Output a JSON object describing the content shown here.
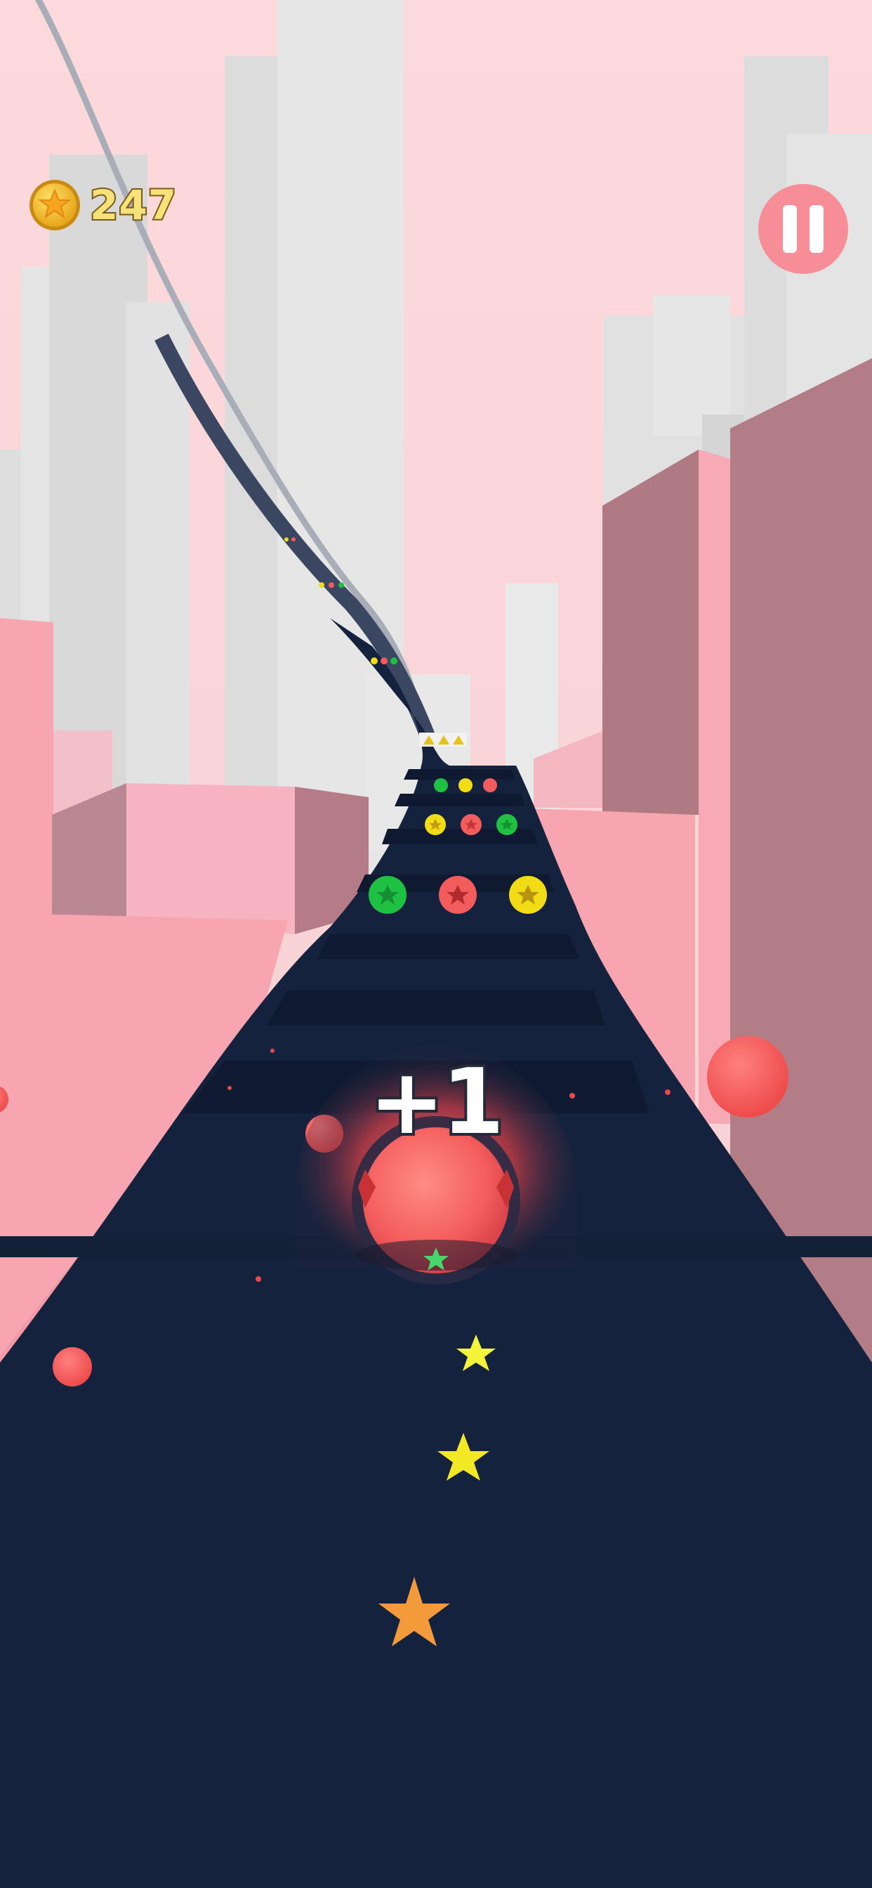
{
  "hud": {
    "coin_icon": "star-coin-icon",
    "coin_count": "247",
    "pause_icon": "pause-icon",
    "score_popup": "+1"
  },
  "player_ball": {
    "color": "red"
  },
  "colors": {
    "sky": "#fbd8da",
    "track": "#15223d",
    "building_pink": "#f6a5b1",
    "building_gray": "#dedede",
    "ball_red": "#f35c5c",
    "ball_green": "#1fc142",
    "ball_yellow": "#f1dc15",
    "coin_gold": "#f5c033",
    "pause_button": "#f78d96"
  }
}
